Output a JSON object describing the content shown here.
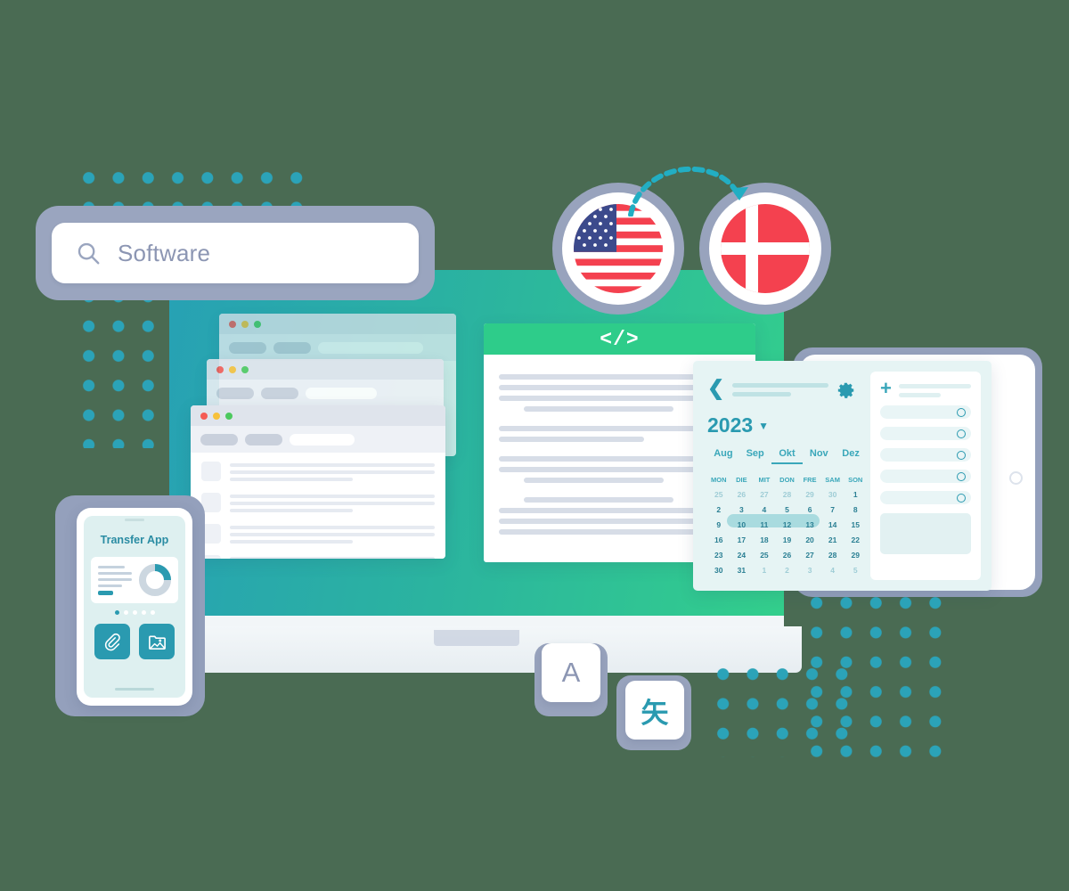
{
  "theme": {
    "background": "#4a6b53",
    "accent_teal": "#2a9ab0",
    "accent_green": "#2ecc8a",
    "slate": "#98a3bd",
    "dot_color": "#2ba3b8",
    "monitor_gradient_from": "#27a1b4",
    "monitor_gradient_to": "#33cf8c",
    "flag_red": "#f9424c"
  },
  "search": {
    "value": "Software",
    "icon": "search-icon"
  },
  "code_window": {
    "header_glyph": "</>",
    "icon": "code-brackets-icon"
  },
  "calendar": {
    "back_icon": "chevron-left-icon",
    "settings_icon": "gear-icon",
    "year": "2023",
    "year_caret": "▼",
    "months": [
      "Aug",
      "Sep",
      "Okt",
      "Nov",
      "Dez"
    ],
    "active_month": "Okt",
    "day_headers": [
      "MON",
      "DIE",
      "MIT",
      "DON",
      "FRE",
      "SAM",
      "SON"
    ],
    "weeks": [
      [
        "25",
        "26",
        "27",
        "28",
        "29",
        "30",
        "1"
      ],
      [
        "2",
        "3",
        "4",
        "5",
        "6",
        "7",
        "8"
      ],
      [
        "9",
        "10",
        "11",
        "12",
        "13",
        "14",
        "15"
      ],
      [
        "16",
        "17",
        "18",
        "19",
        "20",
        "21",
        "22"
      ],
      [
        "23",
        "24",
        "25",
        "26",
        "27",
        "28",
        "29"
      ],
      [
        "30",
        "31",
        "1",
        "2",
        "3",
        "4",
        "5"
      ]
    ],
    "muted_days": [
      "25",
      "26",
      "27",
      "28",
      "29",
      "30",
      "1",
      "2",
      "3",
      "4",
      "5"
    ],
    "selected_range": [
      "10",
      "11",
      "12",
      "13"
    ]
  },
  "task_list": {
    "add_icon": "plus-icon",
    "item_count": 5,
    "item_toggle_icon": "circle-outline-icon"
  },
  "phone": {
    "title": "Transfer App",
    "pagination_dots": 5,
    "active_dot_index": 0,
    "donut_percent": 25,
    "buttons": [
      {
        "name": "attach-button",
        "icon": "paperclip-icon"
      },
      {
        "name": "gallery-button",
        "icon": "folder-image-icon"
      }
    ]
  },
  "flags": {
    "source": {
      "name": "us-flag",
      "label": "United States"
    },
    "target": {
      "name": "denmark-flag",
      "label": "Denmark"
    },
    "transition_icon": "dashed-arrow-icon"
  },
  "language_tiles": [
    {
      "name": "latin-letter-tile",
      "glyph": "A"
    },
    {
      "name": "cjk-character-tile",
      "glyph": "矢"
    }
  ],
  "browser_windows": [
    {
      "name": "browser-window-back"
    },
    {
      "name": "browser-window-middle"
    },
    {
      "name": "browser-window-front"
    }
  ]
}
